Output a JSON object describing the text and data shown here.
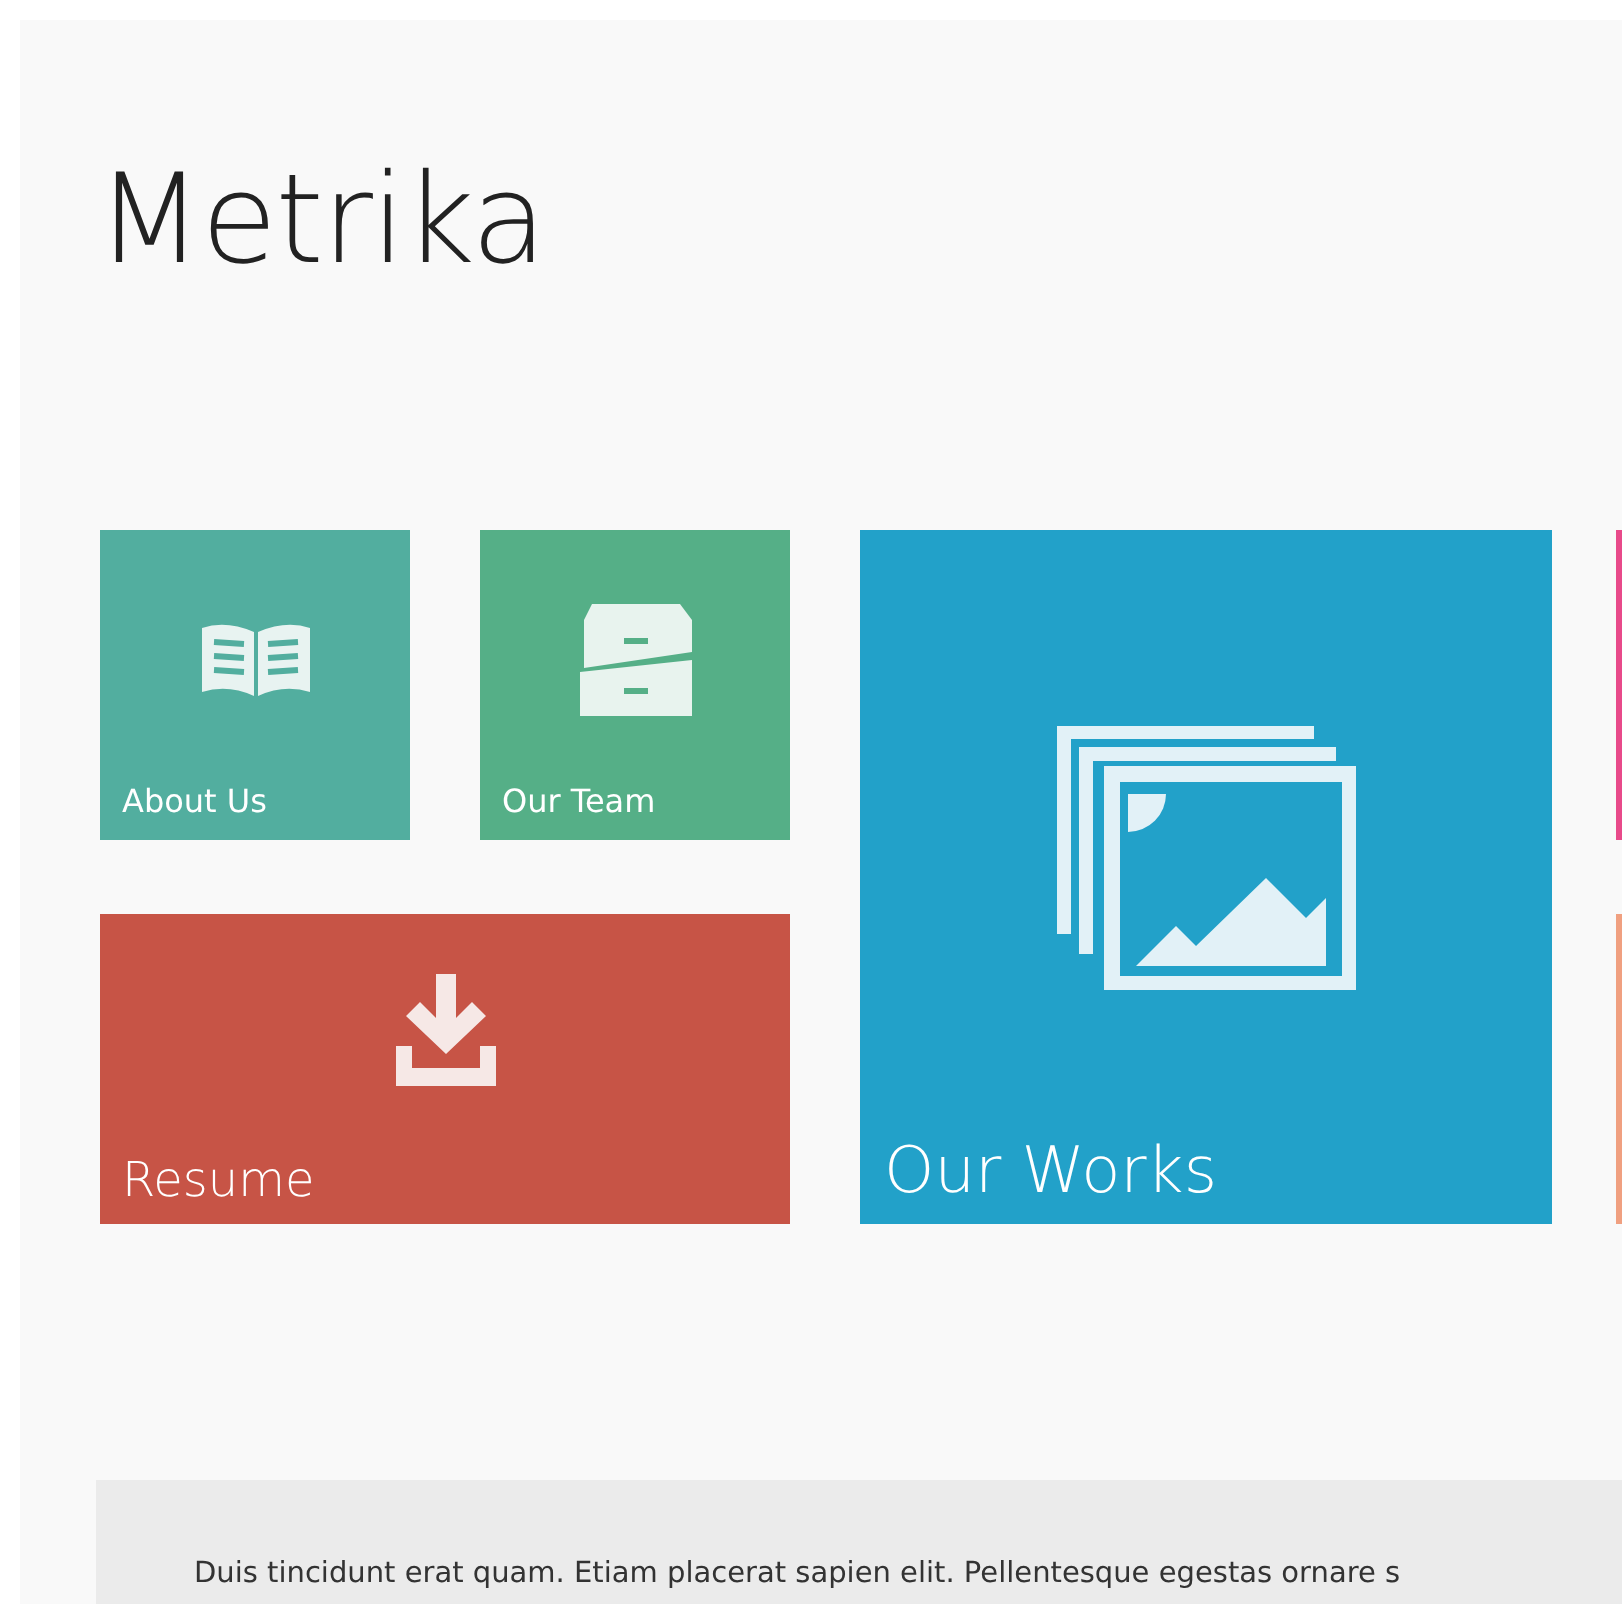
{
  "site_title": "Metrika",
  "tiles": [
    {
      "label": "About Us",
      "kind": "small",
      "color": "#52ae9f"
    },
    {
      "label": "Our Team",
      "kind": "small",
      "color": "#55af87"
    },
    {
      "label": "Resume",
      "kind": "wide",
      "color": "#c75446"
    },
    {
      "label": "Our Works",
      "kind": "large",
      "color": "#22a1c9"
    },
    {
      "kind": "edge",
      "color": "#e84a8a"
    },
    {
      "kind": "edge",
      "color": "#f0a080"
    }
  ],
  "intro_text": "Duis tincidunt erat quam. Etiam placerat sapien elit. Pellentesque egestas ornare s"
}
